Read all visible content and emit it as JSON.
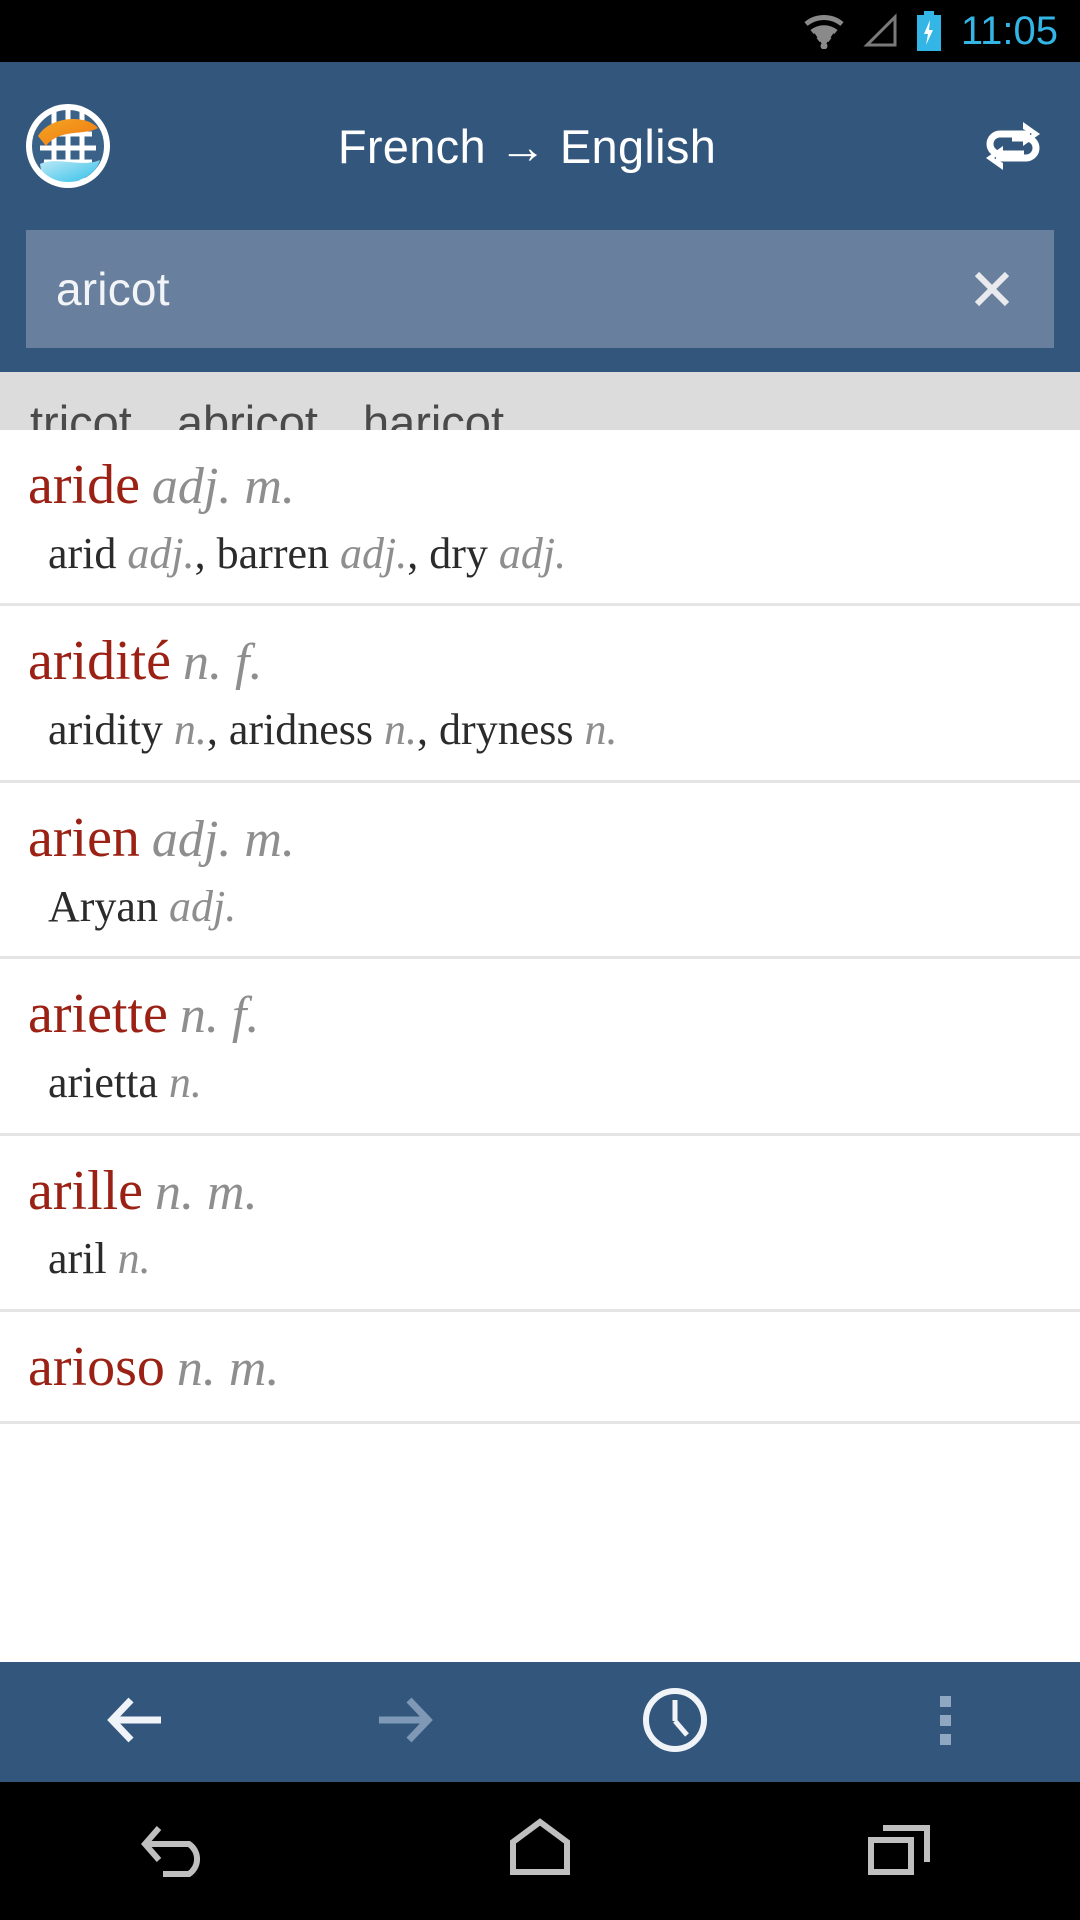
{
  "status_bar": {
    "time": "11:05",
    "time_color": "#33B5E5",
    "icons": [
      "wifi-icon",
      "cellular-signal-icon",
      "battery-charging-icon"
    ]
  },
  "app_header": {
    "logo_icon": "globe-logo-icon",
    "title": "French → English",
    "source_language": "French",
    "target_language": "English",
    "swap_icon": "swap-languages-icon",
    "background_color": "#33577C",
    "title_color": "#FFFFFF"
  },
  "search": {
    "value": "aricot",
    "placeholder": "",
    "clear_icon": "clear-x-icon",
    "field_color": "#68809E"
  },
  "suggestions": {
    "background_color": "#DCDCDC",
    "items": [
      {
        "label": "tricot"
      },
      {
        "label": "abricot"
      },
      {
        "label": "haricot"
      }
    ]
  },
  "results": {
    "headword_color": "#9B2115",
    "pos_color": "#8E8E8E",
    "entries": [
      {
        "headword": "aride",
        "pos": "adj. m.",
        "translations": [
          {
            "term": "arid",
            "pos": "adj."
          },
          {
            "term": "barren",
            "pos": "adj."
          },
          {
            "term": "dry",
            "pos": "adj."
          }
        ]
      },
      {
        "headword": "aridité",
        "pos": "n. f.",
        "translations": [
          {
            "term": "aridity",
            "pos": "n."
          },
          {
            "term": "aridness",
            "pos": "n."
          },
          {
            "term": "dryness",
            "pos": "n."
          }
        ]
      },
      {
        "headword": "arien",
        "pos": "adj. m.",
        "translations": [
          {
            "term": "Aryan",
            "pos": "adj."
          }
        ]
      },
      {
        "headword": "ariette",
        "pos": "n. f.",
        "translations": [
          {
            "term": "arietta",
            "pos": "n."
          }
        ]
      },
      {
        "headword": "arille",
        "pos": "n. m.",
        "translations": [
          {
            "term": "aril",
            "pos": "n."
          }
        ]
      },
      {
        "headword": "arioso",
        "pos": "n. m.",
        "translations": []
      }
    ]
  },
  "toolbar": {
    "background_color": "#33577C",
    "buttons": [
      {
        "name": "back",
        "icon": "arrow-left-icon",
        "enabled": true
      },
      {
        "name": "forward",
        "icon": "arrow-right-icon",
        "enabled": false
      },
      {
        "name": "history",
        "icon": "clock-icon",
        "enabled": true
      },
      {
        "name": "overflow",
        "icon": "overflow-menu-icon",
        "enabled": false
      }
    ]
  },
  "android_nav": {
    "buttons": [
      {
        "name": "back",
        "icon": "android-back-icon"
      },
      {
        "name": "home",
        "icon": "android-home-icon"
      },
      {
        "name": "recents",
        "icon": "android-recents-icon"
      }
    ]
  }
}
